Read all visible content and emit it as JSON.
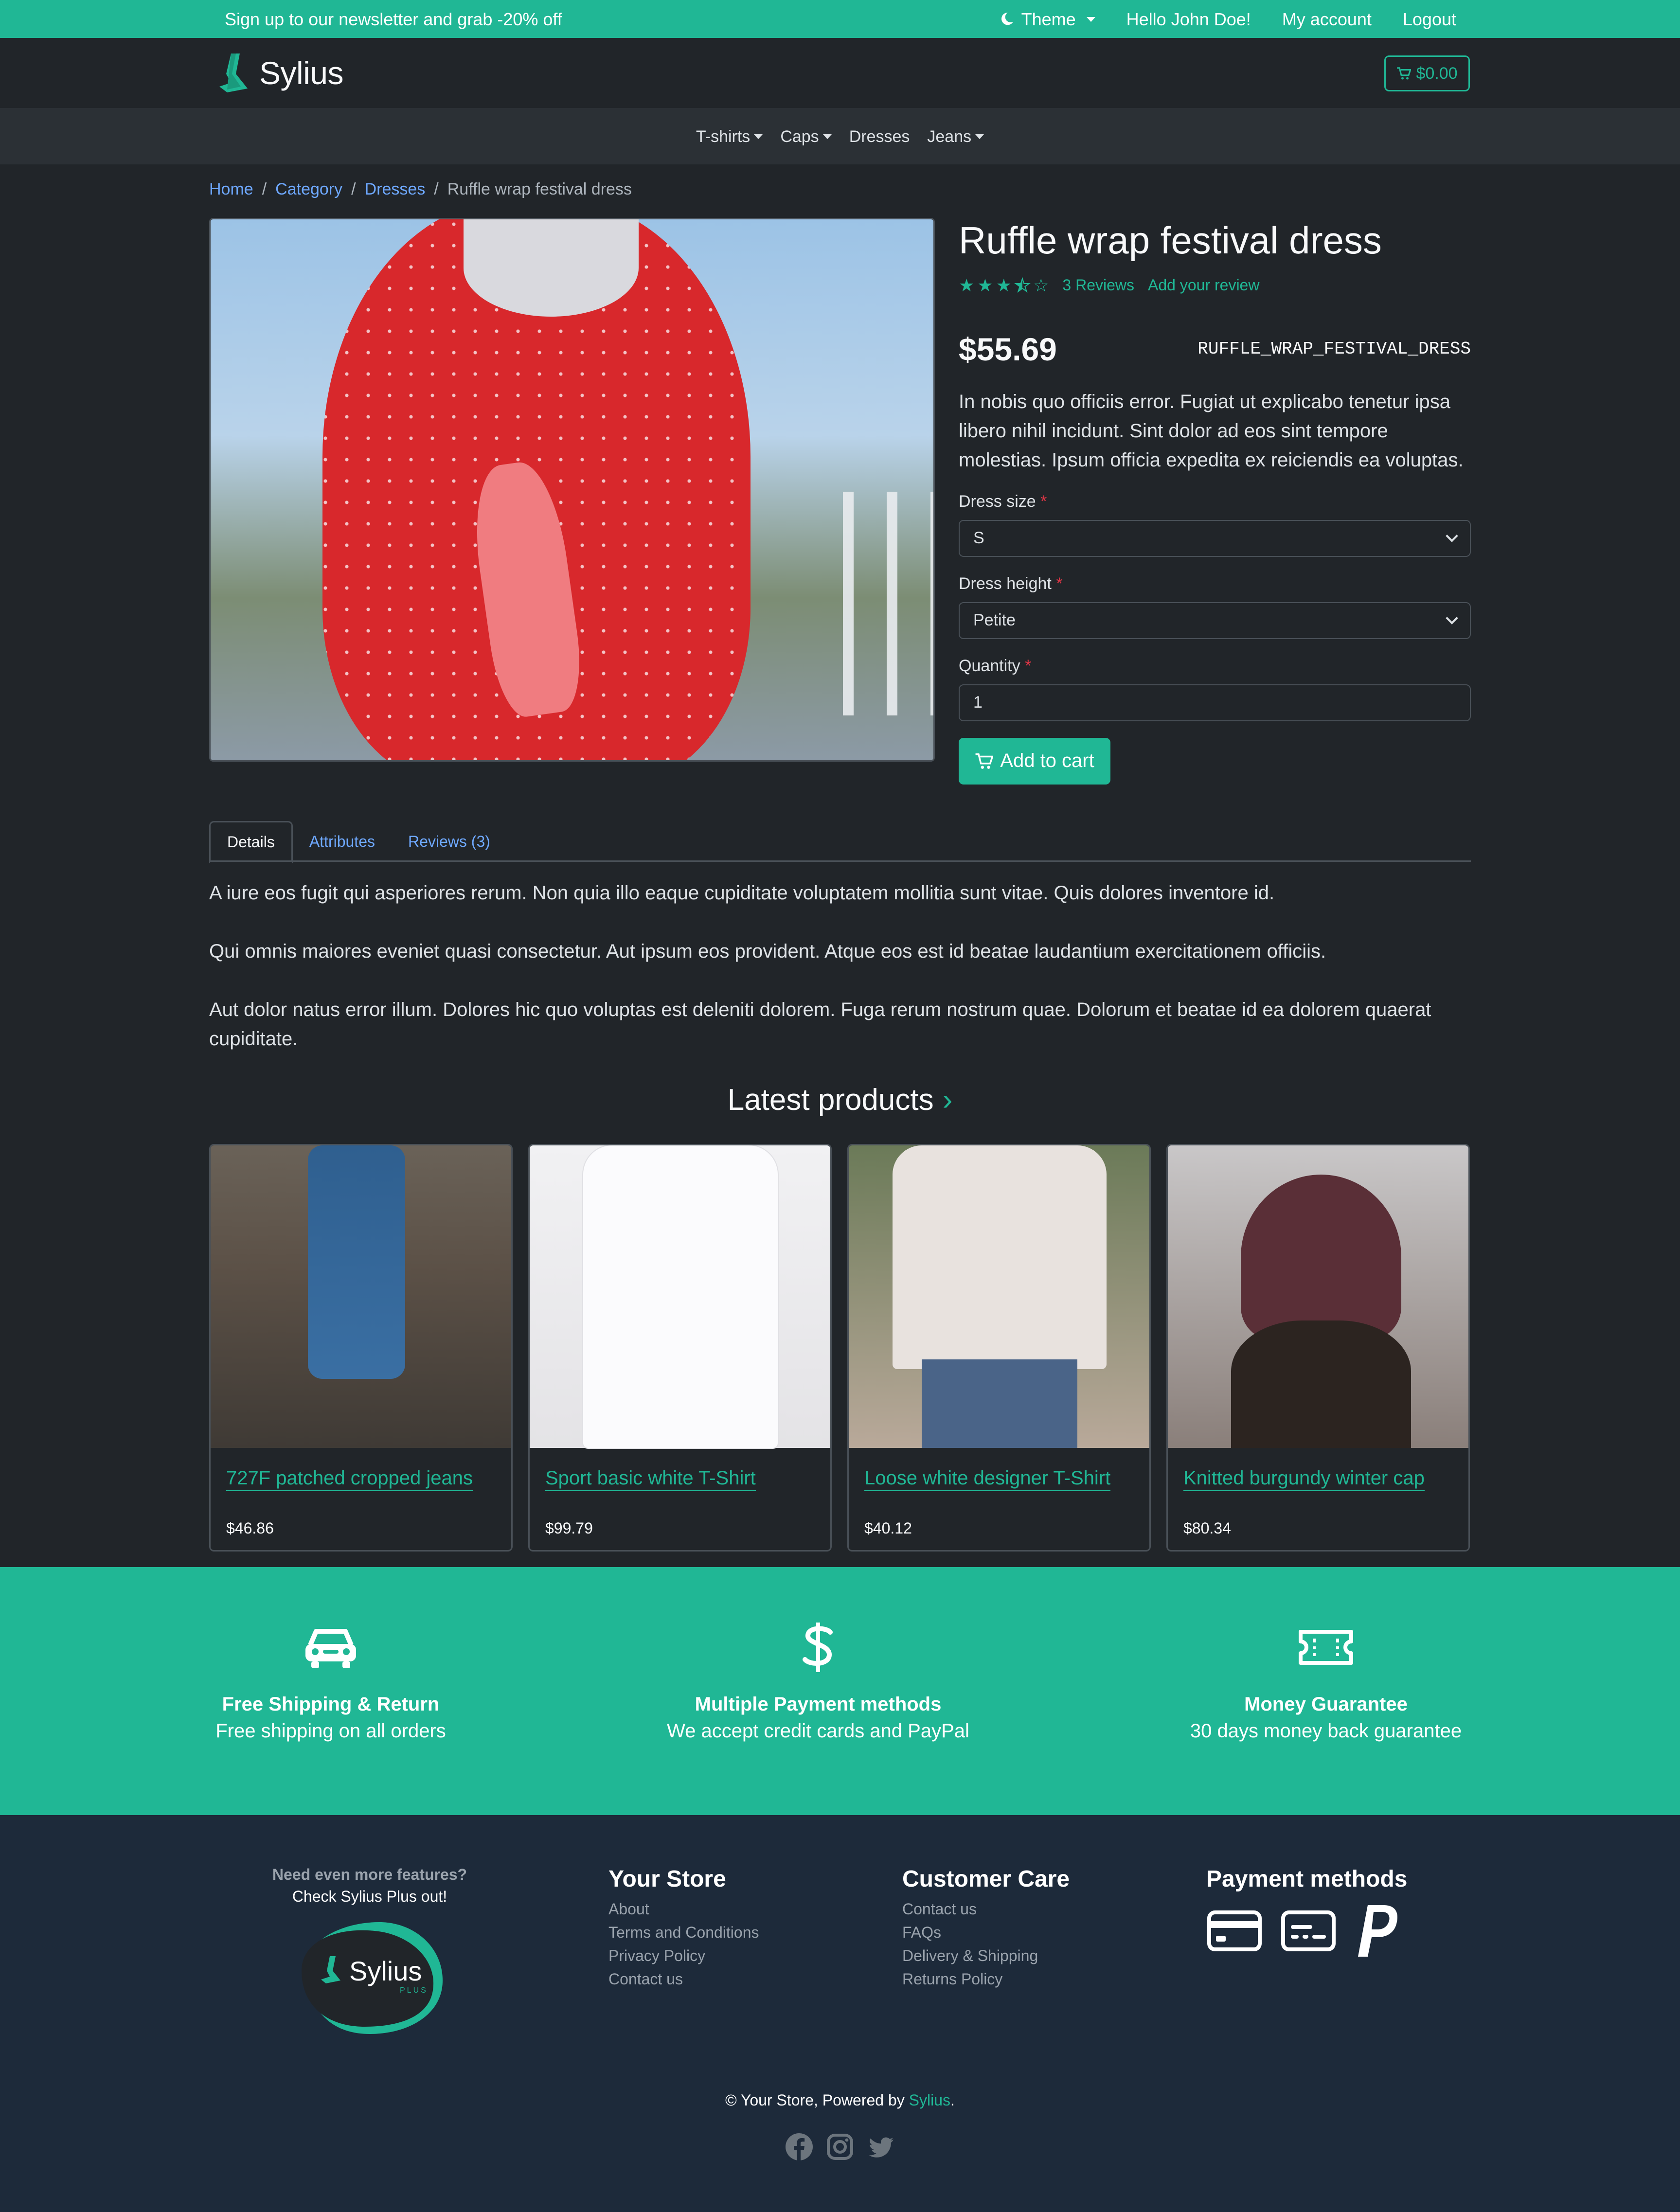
{
  "topbar": {
    "promo": "Sign up to our newsletter and grab -20% off",
    "theme_label": "Theme",
    "greeting": "Hello John Doe!",
    "my_account": "My account",
    "logout": "Logout"
  },
  "header": {
    "logo_text": "Sylius",
    "cart_total": "$0.00"
  },
  "nav": {
    "items": [
      {
        "label": "T-shirts",
        "dropdown": true
      },
      {
        "label": "Caps",
        "dropdown": true
      },
      {
        "label": "Dresses",
        "dropdown": false
      },
      {
        "label": "Jeans",
        "dropdown": true
      }
    ]
  },
  "breadcrumb": {
    "items": [
      "Home",
      "Category",
      "Dresses"
    ],
    "separator": "/",
    "current": "Ruffle wrap festival dress"
  },
  "product": {
    "name": "Ruffle wrap festival dress",
    "rating": 3.5,
    "rating_max": 5,
    "reviews_link": "3 Reviews",
    "add_review_link": "Add your review",
    "price": "$55.69",
    "code": "RUFFLE_WRAP_FESTIVAL_DRESS",
    "description": "In nobis quo officiis error. Fugiat ut explicabo tenetur ipsa libero nihil incidunt. Sint dolor ad eos sint tempore molestias. Ipsum officia expedita ex reiciendis ea voluptas.",
    "options": {
      "size_label": "Dress size",
      "size_value": "S",
      "height_label": "Dress height",
      "height_value": "Petite",
      "quantity_label": "Quantity",
      "quantity_value": "1",
      "required_mark": "*"
    },
    "add_to_cart": "Add to cart"
  },
  "tabs": {
    "items": [
      "Details",
      "Attributes",
      "Reviews (3)"
    ],
    "active": "Details"
  },
  "details": {
    "paragraphs": [
      "A iure eos fugit qui asperiores rerum. Non quia illo eaque cupiditate voluptatem mollitia sunt vitae. Quis dolores inventore id.",
      "Qui omnis maiores eveniet quasi consectetur. Aut ipsum eos provident. Atque eos est id beatae laudantium exercitationem officiis.",
      "Aut dolor natus error illum. Dolores hic quo voluptas est deleniti dolorem. Fuga rerum nostrum quae. Dolorum et beatae id ea dolorem quaerat cupiditate."
    ]
  },
  "latest": {
    "title": "Latest products",
    "arrow": "›",
    "products": [
      {
        "name": "727F patched cropped jeans",
        "price": "$46.86"
      },
      {
        "name": "Sport basic white T-Shirt",
        "price": "$99.79"
      },
      {
        "name": "Loose white designer T-Shirt",
        "price": "$40.12"
      },
      {
        "name": "Knitted burgundy winter cap",
        "price": "$80.34"
      }
    ]
  },
  "features": [
    {
      "icon": "car-icon",
      "title": "Free Shipping & Return",
      "text": "Free shipping on all orders"
    },
    {
      "icon": "dollar-icon",
      "title": "Multiple Payment methods",
      "text": "We accept credit cards and PayPal"
    },
    {
      "icon": "ticket-icon",
      "title": "Money Guarantee",
      "text": "30 days money back guarantee"
    }
  ],
  "footer": {
    "plus_question": "Need even more features?",
    "plus_cta": "Check Sylius Plus out!",
    "plus_logo_text": "Sylius",
    "plus_logo_sub": "PLUS",
    "your_store": {
      "title": "Your Store",
      "links": [
        "About",
        "Terms and Conditions",
        "Privacy Policy",
        "Contact us"
      ]
    },
    "customer_care": {
      "title": "Customer Care",
      "links": [
        "Contact us",
        "FAQs",
        "Delivery & Shipping",
        "Returns Policy"
      ]
    },
    "payment": {
      "title": "Payment methods",
      "icons": [
        "credit-card-icon",
        "card-details-icon",
        "paypal-icon"
      ]
    },
    "copyright_prefix": "© Your Store, Powered by ",
    "copyright_brand": "Sylius",
    "copyright_suffix": ".",
    "socials": [
      "facebook-icon",
      "instagram-icon",
      "twitter-icon"
    ]
  },
  "colors": {
    "accent": "#20b795",
    "page_bg": "#212529",
    "footer_bg": "#1d2a3a",
    "link_blue": "#6ea8fe"
  }
}
